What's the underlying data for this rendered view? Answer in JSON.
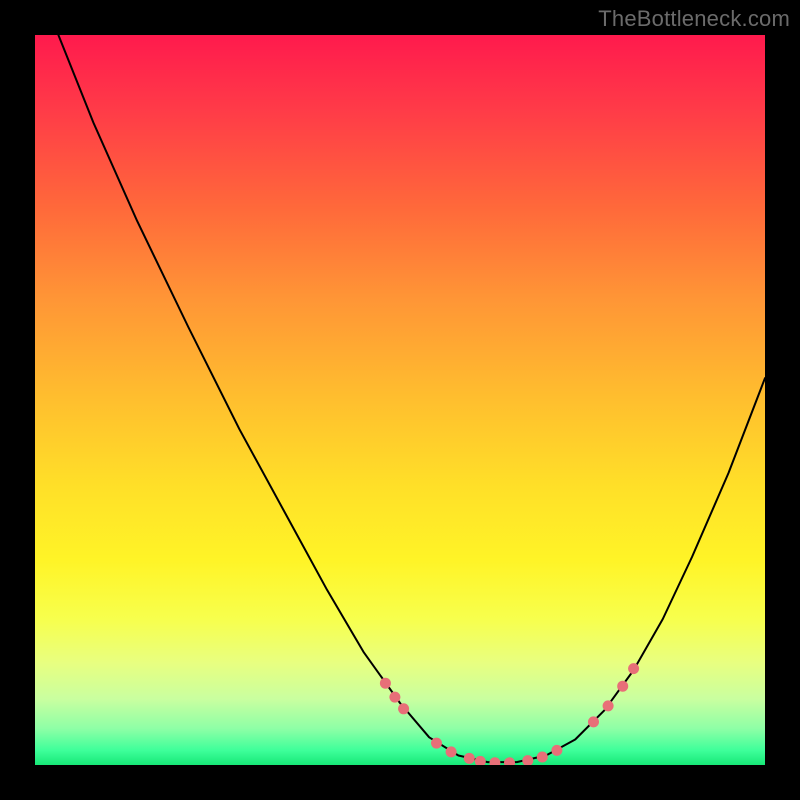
{
  "watermark": "TheBottleneck.com",
  "chart_data": {
    "type": "line",
    "title": "",
    "xlabel": "",
    "ylabel": "",
    "xlim": [
      0,
      100
    ],
    "ylim": [
      0,
      100
    ],
    "grid": false,
    "legend": false,
    "gradient_stops": [
      {
        "pct": 0,
        "color": "#ff1a4d"
      },
      {
        "pct": 10,
        "color": "#ff3a48"
      },
      {
        "pct": 24,
        "color": "#ff6a3a"
      },
      {
        "pct": 36,
        "color": "#ff9536"
      },
      {
        "pct": 50,
        "color": "#ffbf2e"
      },
      {
        "pct": 62,
        "color": "#ffe028"
      },
      {
        "pct": 72,
        "color": "#fff427"
      },
      {
        "pct": 80,
        "color": "#f7ff4d"
      },
      {
        "pct": 86,
        "color": "#e8ff80"
      },
      {
        "pct": 91,
        "color": "#c9ffa0"
      },
      {
        "pct": 95,
        "color": "#8effa6"
      },
      {
        "pct": 98,
        "color": "#3eff9a"
      },
      {
        "pct": 100,
        "color": "#17e877"
      }
    ],
    "series": [
      {
        "name": "bottleneck-curve",
        "color": "#000000",
        "stroke_width": 2,
        "points": [
          {
            "x": 3.2,
            "y": 100.0
          },
          {
            "x": 8.0,
            "y": 88.0
          },
          {
            "x": 14.0,
            "y": 74.5
          },
          {
            "x": 21.0,
            "y": 60.0
          },
          {
            "x": 28.0,
            "y": 46.0
          },
          {
            "x": 34.0,
            "y": 35.0
          },
          {
            "x": 40.0,
            "y": 24.0
          },
          {
            "x": 45.0,
            "y": 15.5
          },
          {
            "x": 50.0,
            "y": 8.5
          },
          {
            "x": 54.0,
            "y": 3.8
          },
          {
            "x": 58.0,
            "y": 1.3
          },
          {
            "x": 62.0,
            "y": 0.4
          },
          {
            "x": 66.0,
            "y": 0.4
          },
          {
            "x": 70.0,
            "y": 1.3
          },
          {
            "x": 74.0,
            "y": 3.5
          },
          {
            "x": 78.0,
            "y": 7.5
          },
          {
            "x": 82.0,
            "y": 13.0
          },
          {
            "x": 86.0,
            "y": 20.0
          },
          {
            "x": 90.0,
            "y": 28.5
          },
          {
            "x": 95.0,
            "y": 40.0
          },
          {
            "x": 100.0,
            "y": 53.0
          }
        ]
      }
    ],
    "markers": {
      "name": "highlighted-points",
      "color": "#e86f78",
      "radius": 5.5,
      "points": [
        {
          "x": 48.0,
          "y": 11.2
        },
        {
          "x": 49.3,
          "y": 9.3
        },
        {
          "x": 50.5,
          "y": 7.7
        },
        {
          "x": 55.0,
          "y": 3.0
        },
        {
          "x": 57.0,
          "y": 1.8
        },
        {
          "x": 59.5,
          "y": 0.9
        },
        {
          "x": 61.0,
          "y": 0.5
        },
        {
          "x": 63.0,
          "y": 0.3
        },
        {
          "x": 65.0,
          "y": 0.3
        },
        {
          "x": 67.5,
          "y": 0.6
        },
        {
          "x": 69.5,
          "y": 1.1
        },
        {
          "x": 71.5,
          "y": 2.0
        },
        {
          "x": 76.5,
          "y": 5.9
        },
        {
          "x": 78.5,
          "y": 8.1
        },
        {
          "x": 80.5,
          "y": 10.8
        },
        {
          "x": 82.0,
          "y": 13.2
        }
      ]
    }
  }
}
